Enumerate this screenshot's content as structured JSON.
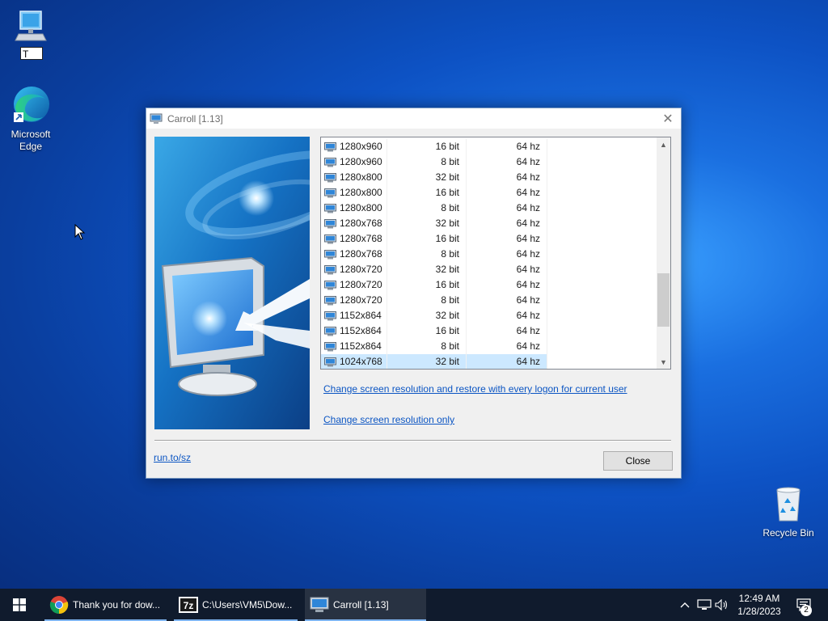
{
  "desktop": {
    "icons": [
      {
        "name": "this-pc",
        "label": "T"
      },
      {
        "name": "microsoft-edge",
        "label": "Microsoft Edge"
      },
      {
        "name": "recycle-bin",
        "label": "Recycle Bin"
      }
    ]
  },
  "window": {
    "title": "Carroll [1.13]",
    "close_glyph": "✕",
    "list": {
      "rows": [
        {
          "res": "1280x960",
          "bit": "16 bit",
          "hz": "64 hz"
        },
        {
          "res": "1280x960",
          "bit": "8 bit",
          "hz": "64 hz"
        },
        {
          "res": "1280x800",
          "bit": "32 bit",
          "hz": "64 hz"
        },
        {
          "res": "1280x800",
          "bit": "16 bit",
          "hz": "64 hz"
        },
        {
          "res": "1280x800",
          "bit": "8 bit",
          "hz": "64 hz"
        },
        {
          "res": "1280x768",
          "bit": "32 bit",
          "hz": "64 hz"
        },
        {
          "res": "1280x768",
          "bit": "16 bit",
          "hz": "64 hz"
        },
        {
          "res": "1280x768",
          "bit": "8 bit",
          "hz": "64 hz"
        },
        {
          "res": "1280x720",
          "bit": "32 bit",
          "hz": "64 hz"
        },
        {
          "res": "1280x720",
          "bit": "16 bit",
          "hz": "64 hz"
        },
        {
          "res": "1280x720",
          "bit": "8 bit",
          "hz": "64 hz"
        },
        {
          "res": "1152x864",
          "bit": "32 bit",
          "hz": "64 hz"
        },
        {
          "res": "1152x864",
          "bit": "16 bit",
          "hz": "64 hz"
        },
        {
          "res": "1152x864",
          "bit": "8 bit",
          "hz": "64 hz"
        },
        {
          "res": "1024x768",
          "bit": "32 bit",
          "hz": "64 hz"
        }
      ],
      "selected_row": "1024x768"
    },
    "link_restore": "Change screen resolution and restore with every logon for current user",
    "link_only": "Change screen resolution only",
    "link_site": "run.to/sz",
    "close_button": "Close"
  },
  "taskbar": {
    "items": [
      {
        "name": "chrome",
        "label": "Thank you for dow..."
      },
      {
        "name": "7zip",
        "label": "C:\\Users\\VM5\\Dow..."
      },
      {
        "name": "carroll",
        "label": "Carroll [1.13]"
      }
    ],
    "time": "12:49 AM",
    "date": "1/28/2023",
    "notification_count": "2"
  }
}
